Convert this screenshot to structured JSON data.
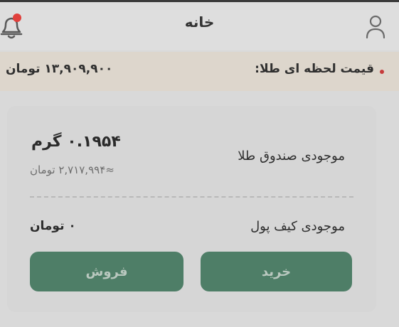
{
  "header": {
    "title": "خانه"
  },
  "price_bar": {
    "label": "قیمت لحظه ای طلا:",
    "value": "۱۳,۹۰۹,۹۰۰ تومان"
  },
  "gold_box": {
    "label": "موجودی صندوق طلا",
    "grams": "۰.۱۹۵۴ گرم",
    "toman": "≈۲,۷۱۷,۹۹۴ تومان"
  },
  "wallet": {
    "label": "موجودی کیف پول",
    "value": "۰ تومان"
  },
  "actions": {
    "buy_label": "خرید",
    "sell_label": "فروش"
  },
  "colors": {
    "accent": "#4e7e67",
    "notification_dot": "#e0403c",
    "price_bar_bg": "#ddd6cc"
  },
  "icons": {
    "left": "bell-icon",
    "right": "user-icon",
    "price_indicator": "live-dot-icon"
  }
}
